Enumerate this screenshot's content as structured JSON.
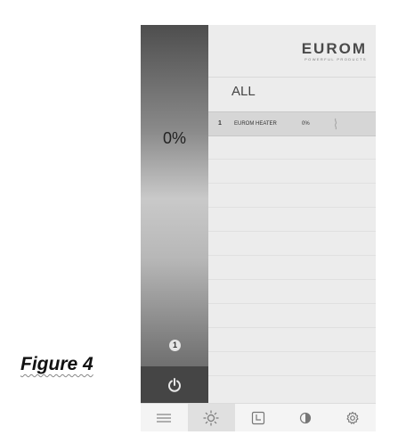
{
  "caption": "Figure 4",
  "sidebar": {
    "level": "0%",
    "badge": "1",
    "power_icon": "power-icon"
  },
  "brand": {
    "name": "EUROM",
    "tagline": "POWERFUL PRODUCTS"
  },
  "group": {
    "title": "ALL"
  },
  "devices": [
    {
      "number": "1",
      "name": "EUROM HEATER",
      "value": "0%",
      "icon": "heater-icon"
    }
  ],
  "tabs": [
    {
      "icon": "list-icon",
      "active": false
    },
    {
      "icon": "sun-icon",
      "active": true
    },
    {
      "icon": "clock-icon",
      "active": false
    },
    {
      "icon": "half-circle-icon",
      "active": false
    },
    {
      "icon": "gear-icon",
      "active": false
    }
  ],
  "colors": {
    "sidebar_dark": "#4e4e4e",
    "sidebar_light": "#c9c9c9",
    "panel_bg": "#ececec",
    "selected_row": "#d6d6d6"
  }
}
